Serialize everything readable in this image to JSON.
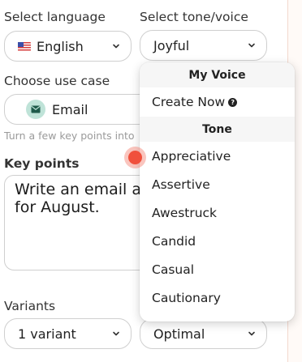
{
  "labels": {
    "select_language": "Select language",
    "select_tone": "Select tone/voice",
    "choose_use_case": "Choose use case",
    "hint": "Turn a few key points into",
    "key_points": "Key points",
    "variants": "Variants"
  },
  "language": {
    "value": "English",
    "flag": "us-flag-icon"
  },
  "tone": {
    "value": "Joyful"
  },
  "use_case": {
    "value": "Email",
    "icon": "mail-icon"
  },
  "key_points_text": "Write an email ab\nfor August.",
  "variants_select": {
    "value": "1 variant"
  },
  "quality_select": {
    "value": "Optimal"
  },
  "tone_menu": {
    "section_my_voice": "My Voice",
    "create_now": "Create Now",
    "section_tone": "Tone",
    "items": [
      "Appreciative",
      "Assertive",
      "Awestruck",
      "Candid",
      "Casual",
      "Cautionary"
    ]
  },
  "colors": {
    "accent_red": "#f0503c",
    "mail_icon_bg": "#bfe3d8"
  }
}
